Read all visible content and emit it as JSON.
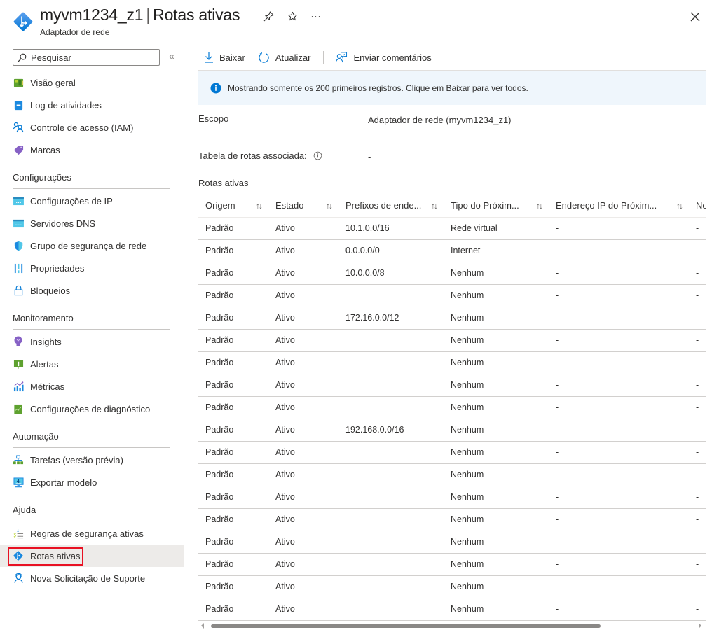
{
  "header": {
    "resource_name": "myvm1234_z1",
    "separator": "|",
    "page_title": "Rotas ativas",
    "subtitle": "Adaptador de rede",
    "pin_icon": "pin-icon",
    "favorite_icon": "star-icon",
    "more_label": "···",
    "close_icon": "close-icon"
  },
  "sidebar": {
    "search_placeholder": "Pesquisar",
    "collapse_label": "«",
    "items": [
      {
        "label": "Visão geral",
        "icon": "overview-icon"
      },
      {
        "label": "Log de atividades",
        "icon": "activity-log-icon"
      },
      {
        "label": "Controle de acesso (IAM)",
        "icon": "iam-icon"
      },
      {
        "label": "Marcas",
        "icon": "tag-icon"
      }
    ],
    "sections": [
      {
        "title": "Configurações",
        "items": [
          {
            "label": "Configurações de IP",
            "icon": "ip-config-icon"
          },
          {
            "label": "Servidores DNS",
            "icon": "dns-icon"
          },
          {
            "label": "Grupo de segurança de rede",
            "icon": "shield-icon"
          },
          {
            "label": "Propriedades",
            "icon": "properties-icon"
          },
          {
            "label": "Bloqueios",
            "icon": "lock-icon"
          }
        ]
      },
      {
        "title": "Monitoramento",
        "items": [
          {
            "label": "Insights",
            "icon": "lightbulb-icon"
          },
          {
            "label": "Alertas",
            "icon": "alert-icon"
          },
          {
            "label": "Métricas",
            "icon": "metrics-icon"
          },
          {
            "label": "Configurações de diagnóstico",
            "icon": "diagnostic-icon"
          }
        ]
      },
      {
        "title": "Automação",
        "items": [
          {
            "label": "Tarefas (versão prévia)",
            "icon": "tasks-icon"
          },
          {
            "label": "Exportar modelo",
            "icon": "export-template-icon"
          }
        ]
      },
      {
        "title": "Ajuda",
        "items": [
          {
            "label": "Regras de segurança ativas",
            "icon": "security-rules-icon"
          },
          {
            "label": "Rotas ativas",
            "icon": "routes-icon",
            "active": true
          },
          {
            "label": "Nova Solicitação de Suporte",
            "icon": "support-icon"
          }
        ]
      }
    ]
  },
  "toolbar": {
    "download_label": "Baixar",
    "refresh_label": "Atualizar",
    "feedback_label": "Enviar comentários"
  },
  "info_bar": {
    "message": "Mostrando somente os 200 primeiros registros. Clique em Baixar para ver todos."
  },
  "properties": {
    "scope_label": "Escopo",
    "scope_value": "Adaptador de rede (myvm1234_z1)",
    "route_table_label": "Tabela de rotas associada:",
    "route_table_value": "-"
  },
  "routes": {
    "title": "Rotas ativas",
    "columns": [
      "Origem",
      "Estado",
      "Prefixos de ende...",
      "Tipo do Próxim...",
      "Endereço IP do Próxim...",
      "No"
    ],
    "rows": [
      [
        "Padrão",
        "Ativo",
        "10.1.0.0/16",
        "Rede virtual",
        "-",
        "-"
      ],
      [
        "Padrão",
        "Ativo",
        "0.0.0.0/0",
        "Internet",
        "-",
        "-"
      ],
      [
        "Padrão",
        "Ativo",
        "10.0.0.0/8",
        "Nenhum",
        "-",
        "-"
      ],
      [
        "Padrão",
        "Ativo",
        "",
        "Nenhum",
        "-",
        "-"
      ],
      [
        "Padrão",
        "Ativo",
        "172.16.0.0/12",
        "Nenhum",
        "-",
        "-"
      ],
      [
        "Padrão",
        "Ativo",
        "",
        "Nenhum",
        "-",
        "-"
      ],
      [
        "Padrão",
        "Ativo",
        "",
        "Nenhum",
        "-",
        "-"
      ],
      [
        "Padrão",
        "Ativo",
        "",
        "Nenhum",
        "-",
        "-"
      ],
      [
        "Padrão",
        "Ativo",
        "",
        "Nenhum",
        "-",
        "-"
      ],
      [
        "Padrão",
        "Ativo",
        "192.168.0.0/16",
        "Nenhum",
        "-",
        "-"
      ],
      [
        "Padrão",
        "Ativo",
        "",
        "Nenhum",
        "-",
        "-"
      ],
      [
        "Padrão",
        "Ativo",
        "",
        "Nenhum",
        "-",
        "-"
      ],
      [
        "Padrão",
        "Ativo",
        "",
        "Nenhum",
        "-",
        "-"
      ],
      [
        "Padrão",
        "Ativo",
        "",
        "Nenhum",
        "-",
        "-"
      ],
      [
        "Padrão",
        "Ativo",
        "",
        "Nenhum",
        "-",
        "-"
      ],
      [
        "Padrão",
        "Ativo",
        "",
        "Nenhum",
        "-",
        "-"
      ],
      [
        "Padrão",
        "Ativo",
        "",
        "Nenhum",
        "-",
        "-"
      ],
      [
        "Padrão",
        "Ativo",
        "",
        "Nenhum",
        "-",
        "-"
      ]
    ]
  },
  "colors": {
    "azure_blue": "#0078d4",
    "info_bg": "#eff6fc",
    "highlight_border": "#e81123",
    "active_bg": "#edebe9"
  }
}
